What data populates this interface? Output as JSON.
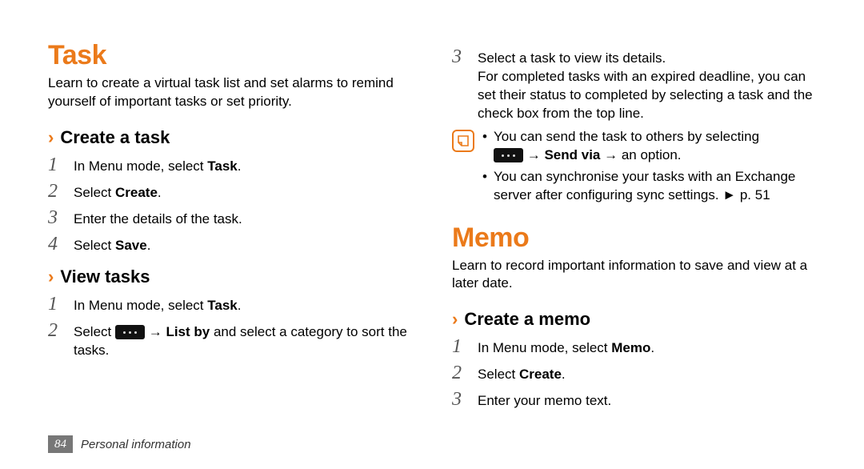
{
  "left": {
    "h1": "Task",
    "lead": "Learn to create a virtual task list and set alarms to remind yourself of important tasks or set priority.",
    "sub1": "Create a task",
    "steps1": {
      "s1a": "In Menu mode, select ",
      "s1b": "Task",
      "s1c": ".",
      "s2a": "Select ",
      "s2b": "Create",
      "s2c": ".",
      "s3": "Enter the details of the task.",
      "s4a": "Select ",
      "s4b": "Save",
      "s4c": "."
    },
    "sub2": "View tasks",
    "steps2": {
      "s1a": "In Menu mode, select ",
      "s1b": "Task",
      "s1c": ".",
      "s2a": "Select ",
      "s2b": " → ",
      "s2c": "List by",
      "s2d": " and select a category to sort the tasks."
    }
  },
  "right": {
    "cont": {
      "s3a": "Select a task to view its details.",
      "s3b": "For completed tasks with an expired deadline, you can set their status to completed by selecting a task and the check box from the top line."
    },
    "note": {
      "b1a": "You can send the task to others by selecting ",
      "b1b": " → ",
      "b1c": "Send via",
      "b1d": " → an option.",
      "b2a": "You can synchronise your tasks with an Exchange server after configuring sync settings. ► p. 51"
    },
    "h1": "Memo",
    "lead": "Learn to record important information to save and view at a later date.",
    "sub1": "Create a memo",
    "steps1": {
      "s1a": "In Menu mode, select ",
      "s1b": "Memo",
      "s1c": ".",
      "s2a": "Select ",
      "s2b": "Create",
      "s2c": ".",
      "s3": "Enter your memo text."
    }
  },
  "footer": {
    "page": "84",
    "section": "Personal information"
  }
}
